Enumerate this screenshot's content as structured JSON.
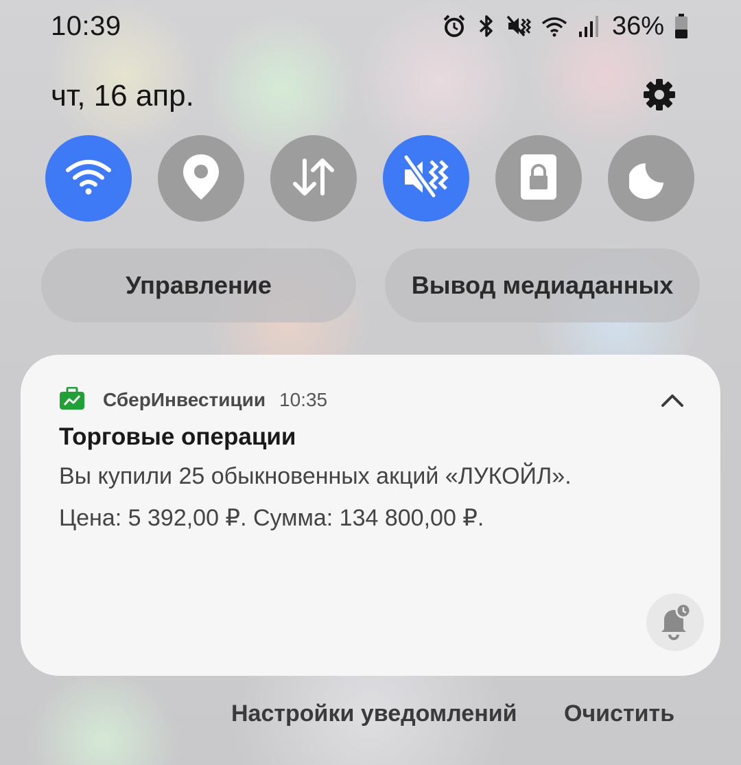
{
  "status_bar": {
    "time": "10:39",
    "battery": "36%",
    "icons": [
      "alarm-icon",
      "bluetooth-icon",
      "vibrate-icon",
      "wifi-icon",
      "signal-icon",
      "battery-icon"
    ]
  },
  "header": {
    "date": "чт, 16 апр.",
    "settings_icon": "gear-icon"
  },
  "quick_settings": [
    {
      "name": "wifi",
      "icon": "wifi-icon",
      "active": true
    },
    {
      "name": "location",
      "icon": "location-pin-icon",
      "active": false
    },
    {
      "name": "mobile-data",
      "icon": "data-arrows-icon",
      "active": false
    },
    {
      "name": "vibrate",
      "icon": "vibrate-icon",
      "active": true
    },
    {
      "name": "secure-folder",
      "icon": "lock-icon",
      "active": false
    },
    {
      "name": "night-mode",
      "icon": "moon-icon",
      "active": false
    }
  ],
  "pills": {
    "device_control": "Управление",
    "media_output": "Вывод медиаданных"
  },
  "notification": {
    "app_name": "СберИнвестиции",
    "time": "10:35",
    "title": "Торговые операции",
    "line1": "Вы купили 25 обыкновенных акций «ЛУКОЙЛ».",
    "line2": "Цена: 5 392,00 ₽. Сумма: 134 800,00 ₽.",
    "app_icon_color": "#21a038",
    "actions": [
      "collapse",
      "snooze"
    ]
  },
  "footer": {
    "settings": "Настройки уведомлений",
    "clear": "Очистить"
  },
  "colors": {
    "accent_blue": "#3e7af6",
    "tile_off": "#9d9d9e",
    "card_bg": "#f6f6f6"
  }
}
